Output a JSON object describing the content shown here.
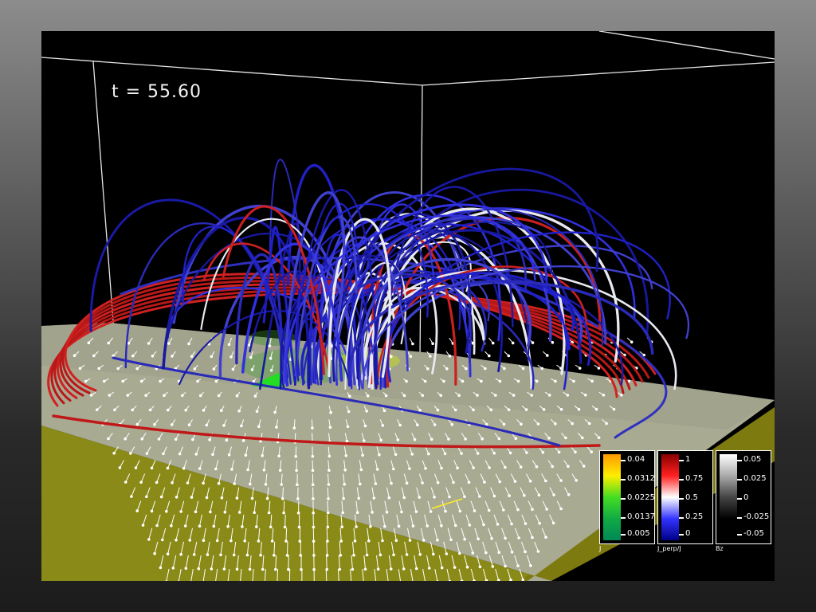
{
  "time_label": "t = 55.60",
  "legends": [
    {
      "title": "J",
      "ticks": [
        "0.04",
        "0.0312",
        "0.0225",
        "0.0137",
        "0.005"
      ],
      "colors": [
        "#ff9900",
        "#ffee00",
        "#44dd22",
        "#11aa44",
        "#008855"
      ]
    },
    {
      "title": "J_perp/J",
      "ticks": [
        "1",
        "0.75",
        "0.5",
        "0.25",
        "0"
      ],
      "colors": [
        "#880000",
        "#ff2020",
        "#ffffff",
        "#3333ff",
        "#000088"
      ]
    },
    {
      "title": "Bz",
      "ticks": [
        "0.05",
        "0.025",
        "0",
        "-0.025",
        "-0.05"
      ],
      "colors": [
        "#ffffff",
        "#aaaaaa",
        "#444444",
        "#000000",
        "#000000"
      ]
    }
  ]
}
